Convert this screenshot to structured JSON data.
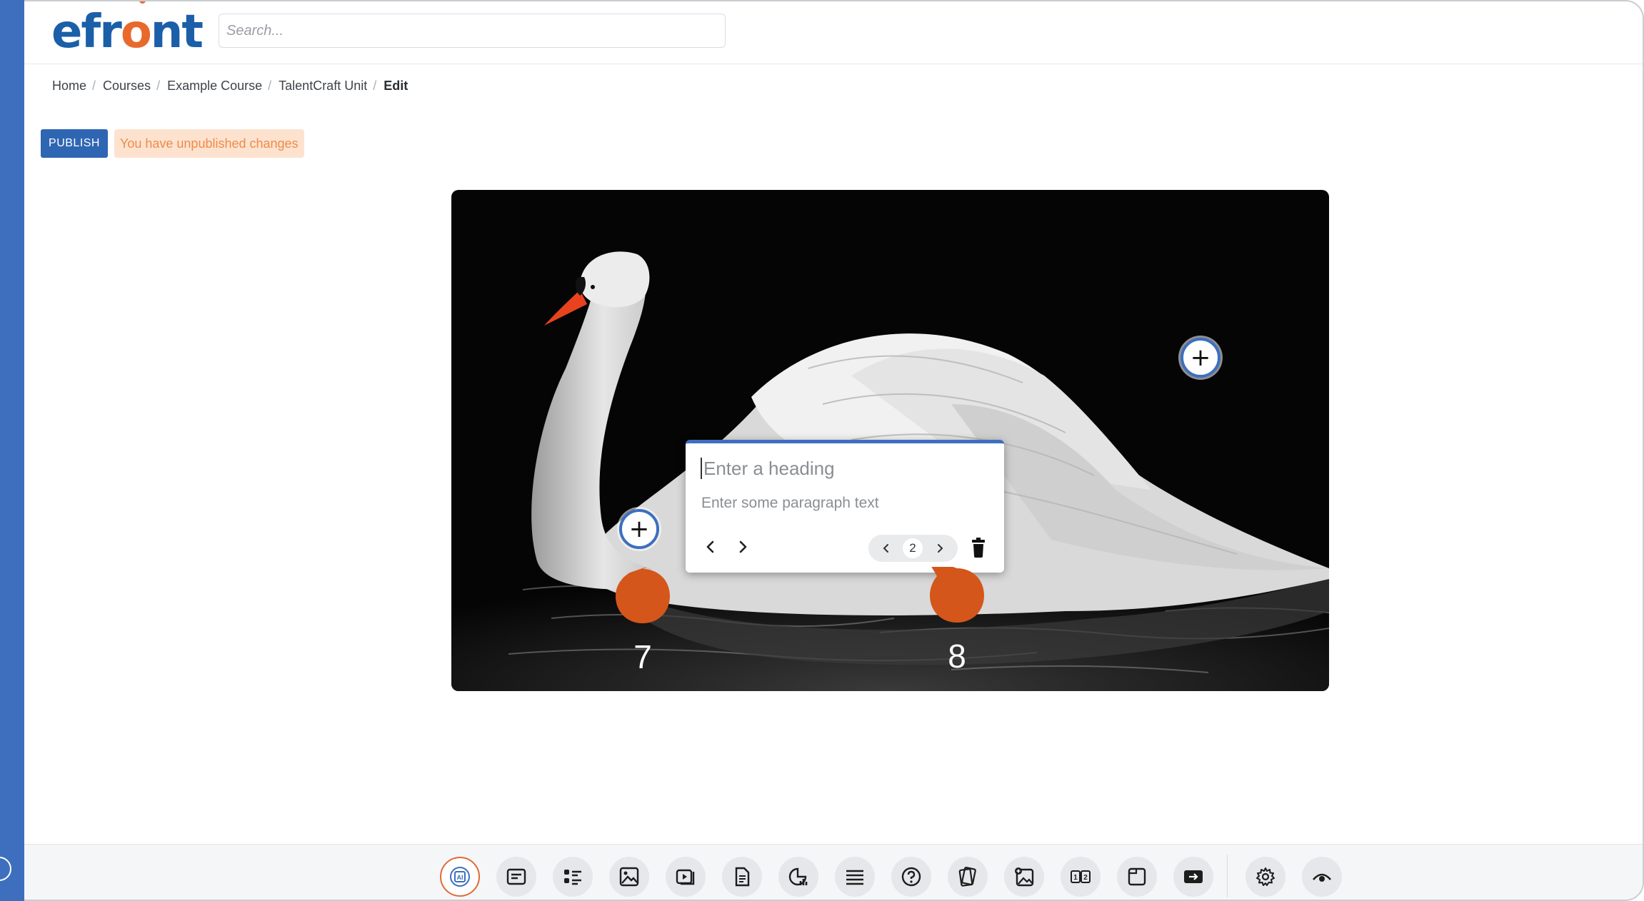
{
  "brand": {
    "logo_prefix": "efr",
    "logo_o": "o",
    "logo_suffix": "nt",
    "primary_color": "#1a5fa8",
    "accent_color": "#e8692b"
  },
  "search": {
    "placeholder": "Search...",
    "value": ""
  },
  "breadcrumb": {
    "items": [
      "Home",
      "Courses",
      "Example Course",
      "TalentCraft Unit"
    ],
    "current": "Edit"
  },
  "publish": {
    "button_label": "PUBLISH",
    "status_text": "You have unpublished changes",
    "button_color": "#2f66b3",
    "status_bg": "#fde3cf",
    "status_color": "#f08a4b"
  },
  "canvas": {
    "hotspots": [
      "add-hotspot",
      "add-hotspot"
    ],
    "card": {
      "heading_placeholder": "Enter a heading",
      "paragraph_placeholder": "Enter some paragraph text",
      "page_number": "2",
      "icons": [
        "chevron-left-icon",
        "chevron-right-icon",
        "trash-icon"
      ]
    },
    "markers": [
      "7",
      "8"
    ],
    "marker_color": "#d4561a"
  },
  "toolbar": {
    "tools": [
      "ai-icon",
      "text-icon",
      "list-icon",
      "image-icon",
      "video-icon",
      "document-icon",
      "chart-icon",
      "lines-icon",
      "question-icon",
      "cards-icon",
      "image-hotspot-icon",
      "compare-icon",
      "window-icon",
      "embed-icon",
      "gear-icon",
      "preview-eye-icon"
    ]
  }
}
